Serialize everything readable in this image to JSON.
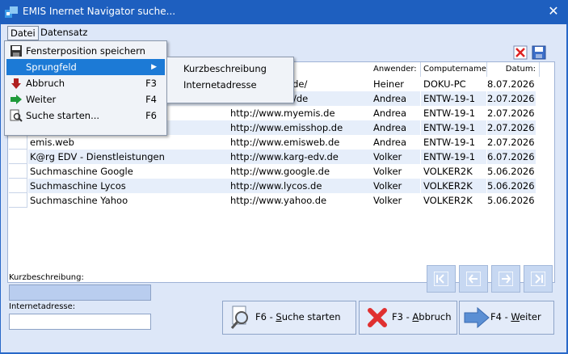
{
  "window": {
    "title": "EMIS Inernet Navigator suche...",
    "close_glyph": "✕"
  },
  "menubar": {
    "datei": "Datei",
    "datensatz": "Datensatz"
  },
  "dropdown": {
    "items": [
      {
        "label": "Fensterposition speichern",
        "shortcut": "",
        "icon": "floppy-icon"
      },
      {
        "label": "Sprungfeld",
        "shortcut": "",
        "icon": "",
        "arrow": "▶"
      },
      {
        "label": "Abbruch",
        "shortcut": "F3",
        "icon": "arrow-down-icon"
      },
      {
        "label": "Weiter",
        "shortcut": "F4",
        "icon": "arrow-right-icon"
      },
      {
        "label": "Suche starten...",
        "shortcut": "F6",
        "icon": "search-document-icon"
      }
    ]
  },
  "submenu": {
    "items": [
      "Kurzbeschreibung",
      "Internetadresse"
    ]
  },
  "table": {
    "headers": {
      "anwender": "Anwender:",
      "computername": "Computername",
      "datum": "Datum:"
    },
    "rows": [
      {
        "name": "",
        "url": "artpage.com/de/",
        "user": "Heiner",
        "computer": "DOKU-PC",
        "date": "8.07.2026"
      },
      {
        "name": "",
        "url": "iscrm.de/hilfe/de",
        "user": "Andrea",
        "computer": "ENTW-19-1",
        "date": "2.07.2026"
      },
      {
        "name": "",
        "url": "http://www.myemis.de",
        "user": "Andrea",
        "computer": "ENTW-19-1",
        "date": "2.07.2026"
      },
      {
        "name": "",
        "url": "http://www.emisshop.de",
        "user": "Andrea",
        "computer": "ENTW-19-1",
        "date": "2.07.2026"
      },
      {
        "name": "emis.web",
        "url": "http://www.emisweb.de",
        "user": "Andrea",
        "computer": "ENTW-19-1",
        "date": "2.07.2026"
      },
      {
        "name": "K@rg EDV - Dienstleistungen",
        "url": "http://www.karg-edv.de",
        "user": "Volker",
        "computer": "ENTW-19-1",
        "date": "6.07.2026"
      },
      {
        "name": "Suchmaschine Google",
        "url": "http://www.google.de",
        "user": "Volker",
        "computer": "VOLKER2K",
        "date": "5.06.2026"
      },
      {
        "name": "Suchmaschine Lycos",
        "url": "http://www.lycos.de",
        "user": "Volker",
        "computer": "VOLKER2K",
        "date": "5.06.2026"
      },
      {
        "name": "Suchmaschine Yahoo",
        "url": "http://www.yahoo.de",
        "user": "Volker",
        "computer": "VOLKER2K",
        "date": "5.06.2026"
      }
    ]
  },
  "form": {
    "kurz_label": "Kurzbeschreibung:",
    "kurz_value": "",
    "internet_label": "Internetadresse:",
    "internet_value": ""
  },
  "buttons": {
    "search_prefix": "F6 - ",
    "search_u": "S",
    "search_rest": "uche starten",
    "abbruch_prefix": "F3 - ",
    "abbruch_u": "A",
    "abbruch_rest": "bbruch",
    "weiter_prefix": "F4 - ",
    "weiter_u": "W",
    "weiter_rest": "eiter"
  }
}
